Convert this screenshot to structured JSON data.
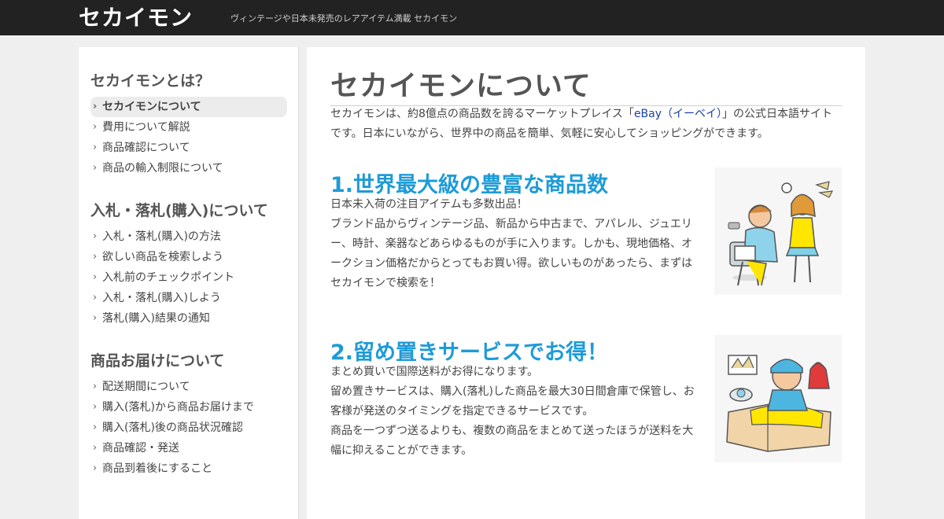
{
  "header": {
    "logo": "セカイモン",
    "tagline": "ヴィンテージや日本未発売のレアアイテム満載 セカイモン"
  },
  "sidebar": {
    "sections": [
      {
        "heading": "セカイモンとは？",
        "items": [
          "セカイモンについて",
          "費用について解説",
          "商品確認について",
          "商品の輸入制限について"
        ],
        "active_index": 0
      },
      {
        "heading": "入札・落札(購入)について",
        "items": [
          "入札・落札(購入)の方法",
          "欲しい商品を検索しよう",
          "入札前のチェックポイント",
          "入札・落札(購入)しよう",
          "落札(購入)結果の通知"
        ]
      },
      {
        "heading": "商品お届けについて",
        "items": [
          "配送期間について",
          "購入(落札)から商品お届けまで",
          "購入(落札)後の商品状況確認",
          "商品確認・発送",
          "商品到着後にすること"
        ]
      }
    ]
  },
  "main": {
    "title": "セカイモンについて",
    "intro_prefix": "セカイモンは、約8億点の商品数を誇るマーケットプレイス「",
    "intro_link": "eBay（イーベイ）",
    "intro_suffix": "」の公式日本語サイトです。日本にいながら、世界中の商品を簡単、気軽に安心してショッピングができます。",
    "features": [
      {
        "title": "1.世界最大級の豊富な商品数",
        "lines": [
          "日本未入荷の注目アイテムも多数出品！",
          "ブランド品からヴィンテージ品、新品から中古まで、アパレル、ジュエリー、時計、楽器などあらゆるものが手に入ります。しかも、現地価格、オークション価格だからとってもお買い得。欲しいものがあったら、まずはセカイモンで検索を！"
        ]
      },
      {
        "title": "2.留め置きサービスでお得！",
        "lines": [
          "まとめ買いで国際送料がお得になります。",
          "留め置きサービスは、購入(落札)した商品を最大30日間倉庫で保管し、お客様が発送のタイミングを指定できるサービスです。",
          "商品を一つずつ送るよりも、複数の商品をまとめて送ったほうが送料を大幅に抑えることができます。"
        ]
      }
    ]
  },
  "colors": {
    "header_bg": "#222222",
    "accent_blue": "#1e9bd7",
    "link": "#1a3fa8"
  }
}
